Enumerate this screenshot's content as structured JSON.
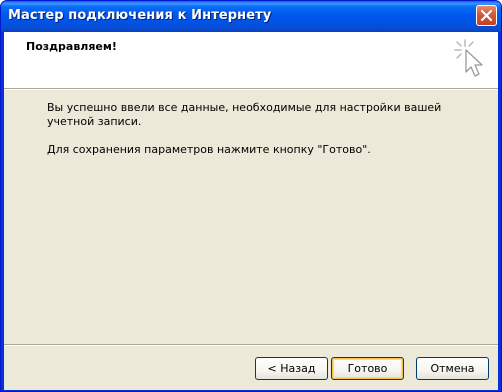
{
  "window": {
    "title": "Мастер подключения к Интернету",
    "close_icon": "close-icon"
  },
  "header": {
    "title": "Поздравляем!",
    "icon": "wizard-sparkle-cursor-icon"
  },
  "content": {
    "paragraph1": "Вы успешно ввели все данные, необходимые для настройки вашей учетной записи.",
    "paragraph2": "Для сохранения параметров нажмите кнопку \"Готово\"."
  },
  "buttons": {
    "back": "< Назад",
    "finish": "Готово",
    "cancel": "Отмена"
  },
  "colors": {
    "titlebar": "#0054e3",
    "dialog_bg": "#ece9d8",
    "close_button": "#d65b3a",
    "default_button_highlight": "#f7c34a"
  }
}
